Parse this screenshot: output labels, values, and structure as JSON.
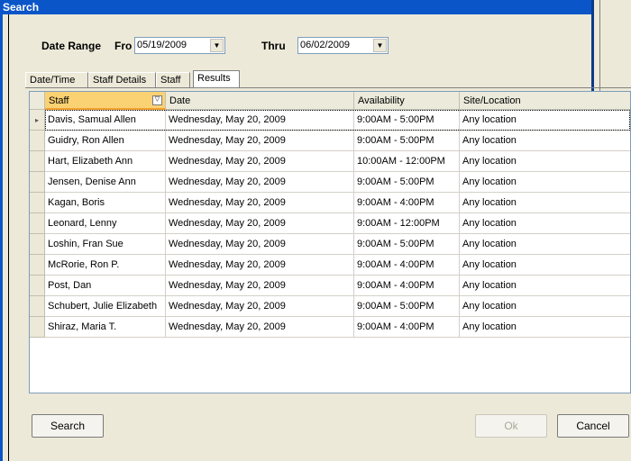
{
  "window": {
    "title": "Search"
  },
  "date_range": {
    "label": "Date Range",
    "from_label": "Fro",
    "from_value": "05/19/2009",
    "thru_label": "Thru",
    "thru_value": "06/02/2009"
  },
  "tabs": [
    {
      "label": "Date/Time",
      "active": false
    },
    {
      "label": "Staff Details",
      "active": false
    },
    {
      "label": "Staff",
      "active": false
    },
    {
      "label": "Results",
      "active": true
    }
  ],
  "grid": {
    "columns": [
      "Staff",
      "Date",
      "Availability",
      "Site/Location"
    ],
    "rows": [
      [
        "Davis, Samual Allen",
        "Wednesday, May 20, 2009",
        "9:00AM - 5:00PM",
        "Any location"
      ],
      [
        "Guidry, Ron Allen",
        "Wednesday, May 20, 2009",
        "9:00AM - 5:00PM",
        "Any location"
      ],
      [
        "Hart, Elizabeth Ann",
        "Wednesday, May 20, 2009",
        "10:00AM - 12:00PM",
        "Any location"
      ],
      [
        "Jensen, Denise Ann",
        "Wednesday, May 20, 2009",
        "9:00AM - 5:00PM",
        "Any location"
      ],
      [
        "Kagan, Boris",
        "Wednesday, May 20, 2009",
        "9:00AM - 4:00PM",
        "Any location"
      ],
      [
        "Leonard, Lenny",
        "Wednesday, May 20, 2009",
        "9:00AM - 12:00PM",
        "Any location"
      ],
      [
        "Loshin, Fran Sue",
        "Wednesday, May 20, 2009",
        "9:00AM - 5:00PM",
        "Any location"
      ],
      [
        "McRorie, Ron P.",
        "Wednesday, May 20, 2009",
        "9:00AM - 4:00PM",
        "Any location"
      ],
      [
        "Post, Dan",
        "Wednesday, May 20, 2009",
        "9:00AM - 4:00PM",
        "Any location"
      ],
      [
        "Schubert, Julie Elizabeth",
        "Wednesday, May 20, 2009",
        "9:00AM - 5:00PM",
        "Any location"
      ],
      [
        "Shiraz, Maria T.",
        "Wednesday, May 20, 2009",
        "9:00AM - 4:00PM",
        "Any location"
      ]
    ]
  },
  "buttons": {
    "search": "Search",
    "ok": "Ok",
    "cancel": "Cancel"
  },
  "colors": {
    "titlebar": "#0a55c8",
    "sorted_header": "#fbd273",
    "background": "#ece9d8"
  }
}
